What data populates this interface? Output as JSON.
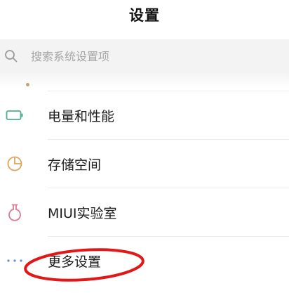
{
  "header": {
    "title": "设置"
  },
  "search": {
    "placeholder": "搜索系统设置项",
    "icon": "search-icon"
  },
  "settings_items": [
    {
      "label": "电量和性能",
      "icon": "battery-icon",
      "icon_color": "#4fae8f"
    },
    {
      "label": "存储空间",
      "icon": "pie-chart-icon",
      "icon_color": "#e0a45a"
    },
    {
      "label": "MIUI实验室",
      "icon": "flask-icon",
      "icon_color": "#d97c94"
    },
    {
      "label": "更多设置",
      "icon": "more-dots-icon",
      "icon_color": "#5b8fd6"
    }
  ],
  "annotation": {
    "shape": "ellipse",
    "color": "#e01818"
  }
}
